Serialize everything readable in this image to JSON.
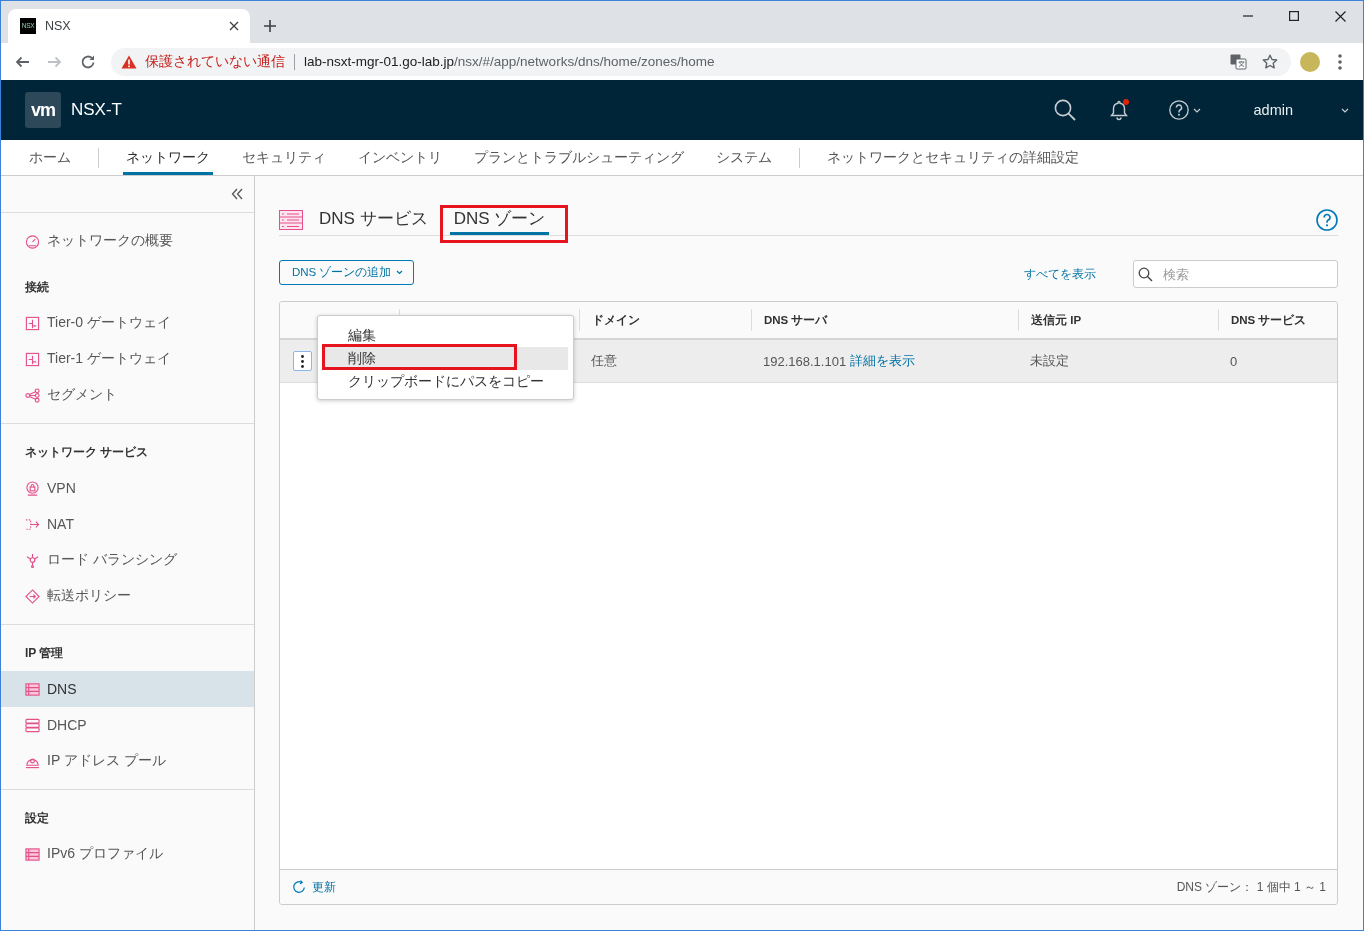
{
  "browser": {
    "tab": {
      "favicon_text": "NSX",
      "title": "NSX"
    },
    "navigation": {
      "forward_disabled": true
    },
    "address": {
      "security_label": "保護されていない通信",
      "url_host": "lab-nsxt-mgr-01.go-lab.jp",
      "url_path": "/nsx/#/app/networks/dns/home/zones/home"
    }
  },
  "header": {
    "logo_text": "vm",
    "product": "NSX-T",
    "has_notification": true,
    "user": "admin"
  },
  "nav": {
    "groups": [
      {
        "tabs": [
          {
            "label": "ホーム",
            "selected": false
          }
        ]
      },
      {
        "tabs": [
          {
            "label": "ネットワーク",
            "selected": true
          },
          {
            "label": "セキュリティ",
            "selected": false
          },
          {
            "label": "インベントリ",
            "selected": false
          },
          {
            "label": "プランとトラブルシューティング",
            "selected": false
          },
          {
            "label": "システム",
            "selected": false
          }
        ]
      },
      {
        "tabs": [
          {
            "label": "ネットワークとセキュリティの詳細設定",
            "selected": false
          }
        ]
      }
    ]
  },
  "sidebar": {
    "sections": [
      {
        "entries": [
          {
            "kind": "item",
            "label": "ネットワークの概要",
            "selected": false
          },
          {
            "kind": "heading",
            "label": "接続"
          },
          {
            "kind": "item",
            "label": "Tier-0 ゲートウェイ",
            "selected": false
          },
          {
            "kind": "item",
            "label": "Tier-1 ゲートウェイ",
            "selected": false
          },
          {
            "kind": "item",
            "label": "セグメント",
            "selected": false
          }
        ]
      },
      {
        "entries": [
          {
            "kind": "heading",
            "label": "ネットワーク サービス"
          },
          {
            "kind": "item",
            "label": "VPN",
            "selected": false
          },
          {
            "kind": "item",
            "label": "NAT",
            "selected": false
          },
          {
            "kind": "item",
            "label": "ロード バランシング",
            "selected": false
          },
          {
            "kind": "item",
            "label": "転送ポリシー",
            "selected": false
          }
        ]
      },
      {
        "entries": [
          {
            "kind": "heading",
            "label": "IP 管理"
          },
          {
            "kind": "item",
            "label": "DNS",
            "selected": true
          },
          {
            "kind": "item",
            "label": "DHCP",
            "selected": false
          },
          {
            "kind": "item",
            "label": "IP アドレス プール",
            "selected": false
          }
        ]
      },
      {
        "entries": [
          {
            "kind": "heading",
            "label": "設定"
          },
          {
            "kind": "item",
            "label": "IPv6 プロファイル",
            "selected": false
          }
        ]
      }
    ]
  },
  "page": {
    "tabs": [
      {
        "label": "DNS サービス",
        "selected": false,
        "highlighted": false
      },
      {
        "label": "DNS ゾーン",
        "selected": true,
        "highlighted": true
      }
    ],
    "add_button": "DNS ゾーンの追加",
    "show_all_link": "すべてを表示",
    "search": {
      "placeholder": "検索"
    }
  },
  "table": {
    "columns": [
      {
        "kind": "actions"
      },
      {
        "kind": "covered"
      },
      {
        "kind": "text",
        "label": "ドメイン"
      },
      {
        "kind": "text",
        "label": "DNS サーバ"
      },
      {
        "kind": "text",
        "label": "送信元 IP"
      },
      {
        "kind": "text",
        "label": "DNS サービス"
      }
    ],
    "rows": [
      {
        "hovered": true,
        "menu_open": true,
        "cells": [
          {
            "kind": "actions"
          },
          {
            "kind": "covered"
          },
          {
            "kind": "text",
            "text": "任意"
          },
          {
            "kind": "server",
            "text": "192.168.1.101",
            "link": "詳細を表示"
          },
          {
            "kind": "text",
            "text": "未設定"
          },
          {
            "kind": "text",
            "text": "0"
          }
        ],
        "menu": [
          {
            "label": "編集",
            "hovered": false,
            "highlighted": false
          },
          {
            "label": "削除",
            "hovered": true,
            "highlighted": true
          },
          {
            "label": "クリップボードにパスをコピー",
            "hovered": false,
            "highlighted": false
          }
        ]
      }
    ],
    "footer": {
      "refresh": "更新",
      "summary": "DNS ゾーン： 1 個中 1 ～ 1"
    }
  }
}
